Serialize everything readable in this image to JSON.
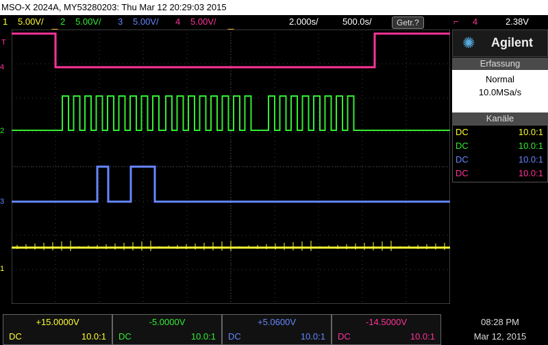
{
  "title": "MSO-X 2024A, MY53280203: Thu Mar 12 20:29:03 2015",
  "status": {
    "ch1": {
      "num": "1",
      "scale": "5.00V/",
      "color": "#ffff33"
    },
    "ch2": {
      "num": "2",
      "scale": "5.00V/",
      "color": "#33ee33"
    },
    "ch3": {
      "num": "3",
      "scale": "5.00V/",
      "color": "#6688ff"
    },
    "ch4": {
      "num": "4",
      "scale": "5.00V/",
      "color": "#ff3399"
    },
    "timebase": "2.000s/",
    "delay": "500.0s/",
    "trigger_button": "Getr.?",
    "trigger_channel": "4",
    "trigger_level": "2.38V"
  },
  "side": {
    "brand": "Agilent",
    "acq_head": "Erfassung",
    "acq_mode": "Normal",
    "acq_rate": "10.0MSa/s",
    "ch_head": "Kanäle",
    "channels": [
      {
        "coupling": "DC",
        "ratio": "10.0:1",
        "color": "#ffff33"
      },
      {
        "coupling": "DC",
        "ratio": "10.0:1",
        "color": "#33ee33"
      },
      {
        "coupling": "DC",
        "ratio": "10.0:1",
        "color": "#6688ff"
      },
      {
        "coupling": "DC",
        "ratio": "10.0:1",
        "color": "#ff3399"
      }
    ]
  },
  "screen": {
    "markers": {
      "ch1": "1",
      "ch2": "2",
      "ch3": "3",
      "ch4": "4",
      "trig": "T"
    }
  },
  "bottom": [
    {
      "value": "+15.0000V",
      "coupling": "DC",
      "ratio": "10.0:1",
      "color": "#ffff33"
    },
    {
      "value": "-5.0000V",
      "coupling": "DC",
      "ratio": "10.0:1",
      "color": "#33ee33"
    },
    {
      "value": "+5.0600V",
      "coupling": "DC",
      "ratio": "10.0:1",
      "color": "#6688ff"
    },
    {
      "value": "-14.5000V",
      "coupling": "DC",
      "ratio": "10.0:1",
      "color": "#ff3399"
    }
  ],
  "clock": {
    "time": "08:28 PM",
    "date": "Mar 12, 2015"
  }
}
